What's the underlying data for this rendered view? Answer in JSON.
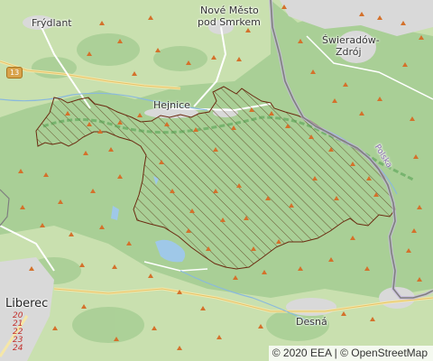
{
  "map": {
    "places": [
      {
        "key": "frydlant",
        "label": "Frýdlant"
      },
      {
        "key": "nove_mesto_1",
        "label": "Nové Město"
      },
      {
        "key": "nove_mesto_2",
        "label": "pod Smrkem"
      },
      {
        "key": "swieradow_1",
        "label": "Świeradów-"
      },
      {
        "key": "swieradow_2",
        "label": "Zdrój"
      },
      {
        "key": "hejnice",
        "label": "Hejnice"
      },
      {
        "key": "liberec",
        "label": "Liberec"
      },
      {
        "key": "desna",
        "label": "Desná"
      }
    ],
    "border_label": "Polska",
    "route_shield": "13",
    "route_numbers": [
      "20",
      "21",
      "22",
      "23",
      "24"
    ],
    "colors": {
      "forest": "#a9cf96",
      "area_hatch": "#5b3b1a",
      "area_outline": "#6b2a10",
      "peak": "#d4712b",
      "border": "#7f7f7f",
      "urban": "#d9d9d9"
    }
  },
  "attribution": {
    "prefix": "© 2020 EEA",
    "separator": "|",
    "osm": "© OpenStreetMap"
  }
}
